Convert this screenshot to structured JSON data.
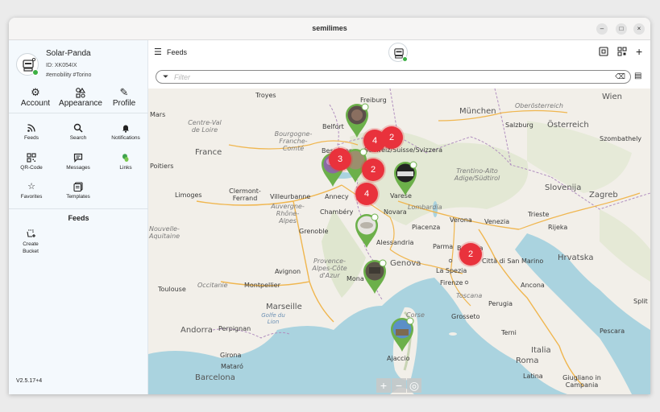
{
  "window": {
    "title": "semilimes",
    "controls": [
      "–",
      "□",
      "×"
    ]
  },
  "profile": {
    "name": "Solar-Panda",
    "id": "ID: XK054IX",
    "tags": "#emobility #Torino"
  },
  "top_nav": [
    {
      "label": "Account",
      "icon": "⚙"
    },
    {
      "label": "Appearance",
      "icon": "⚙"
    },
    {
      "label": "Profile",
      "icon": "✎"
    }
  ],
  "nav_items": [
    {
      "label": "Feeds",
      "icon": "wifi-icon"
    },
    {
      "label": "Search",
      "icon": "search-icon"
    },
    {
      "label": "Notifications",
      "icon": "bell-icon"
    },
    {
      "label": "QR-Code",
      "icon": "qr-icon"
    },
    {
      "label": "Messages",
      "icon": "message-icon"
    },
    {
      "label": "Links",
      "icon": "links-icon"
    },
    {
      "label": "Favorites",
      "icon": "star-icon"
    },
    {
      "label": "Templates",
      "icon": "template-icon"
    }
  ],
  "feeds_section": {
    "title": "Feeds",
    "create_label": "Create Bucket"
  },
  "version": "V2.5.17+4",
  "header": {
    "title": "Feeds"
  },
  "filter": {
    "placeholder": "Filter"
  },
  "map": {
    "clusters": [
      "4",
      "2",
      "3",
      "2",
      "4",
      "2"
    ],
    "labels": {
      "troyes": "Troyes",
      "freiburg": "Freiburg",
      "munchen": "München",
      "wien": "Wien",
      "mars": "Mars",
      "centre": "Centre-Val de Loire",
      "bourgogne": "Bourgogne-Franche-Comté",
      "besancon": "Besançon",
      "belfort": "Belfort",
      "schweiz": "Schweiz/Suisse/Svizzera",
      "oberosterreich": "Oberösterreich",
      "salzburg": "Salzburg",
      "osterreich": "Österreich",
      "szombathely": "Szombathely",
      "france": "France",
      "poitiers": "Poitiers",
      "trentino": "Trentino-Alto Adige/Südtirol",
      "slovenija": "Slovenija",
      "limoges": "Limoges",
      "clermont": "Clermont-Ferrand",
      "villeurbanne": "Villeurbanne",
      "annecy": "Annecy",
      "varese": "Varese",
      "zagreb": "Zagreb",
      "auvergne": "Auvergne-Rhône-Alpes",
      "chambery": "Chambéry",
      "novara": "Novara",
      "lombardia": "Lombardia",
      "verona": "Verona",
      "venezia": "Venezia",
      "trieste": "Trieste",
      "rijeka": "Rijeka",
      "grenoble": "Grenoble",
      "piacenza": "Piacenza",
      "nouvelle": "Nouvelle-Aquitaine",
      "alessandria": "Alessandria",
      "parma": "Parma",
      "bologna": "Bologna",
      "hrvatska": "Hrvatska",
      "provence": "Provence-Alpes-Côte d'Azur",
      "genova": "Genova",
      "laspezia": "La Spezia",
      "citta": "Città di San Marino",
      "avignon": "Avignon",
      "toulouse": "Toulouse",
      "occitanie": "Occitanie",
      "montpellier": "Montpellier",
      "monaco": "Mona",
      "firenze": "Firenze",
      "ancona": "Ancona",
      "toscana": "Toscana",
      "perugia": "Perugia",
      "marseille": "Marseille",
      "golfe": "Golfe du Lion",
      "grosseto": "Grosseto",
      "andorra": "Andorra",
      "perpignan": "Perpignan",
      "terni": "Terni",
      "italia": "Italia",
      "girona": "Girona",
      "mataro": "Mataró",
      "ajaccio": "Ajaccio",
      "roma": "Roma",
      "barcelona": "Barcelona",
      "latina": "Latina",
      "giugliano": "Giugliano in Campania",
      "split": "Split",
      "pescara": "Pescara",
      "corse": "Corse"
    },
    "zoom": {
      "in": "+",
      "out": "−",
      "locate": "◎"
    }
  }
}
